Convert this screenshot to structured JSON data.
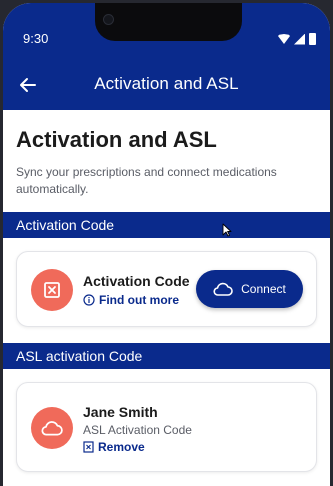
{
  "status_bar": {
    "time": "9:30"
  },
  "app_bar": {
    "title": "Activation and ASL",
    "back_icon": "arrow-left-icon"
  },
  "page": {
    "title": "Activation and ASL",
    "subtitle": "Sync your prescriptions and connect medications automatically."
  },
  "sections": {
    "activation": {
      "header": "Activation Code",
      "card": {
        "icon": "prescription-pad-icon",
        "title": "Activation Code",
        "link_label": "Find out more",
        "link_icon": "info-icon",
        "button_label": "Connect",
        "button_icon": "cloud-icon"
      }
    },
    "asl": {
      "header": "ASL activation Code",
      "card": {
        "icon": "cloud-icon",
        "name": "Jane Smith",
        "subtitle": "ASL Activation Code",
        "remove_label": "Remove",
        "remove_icon": "remove-icon"
      }
    }
  },
  "colors": {
    "primary": "#0a2a8c",
    "accent": "#f06a5a",
    "text": "#1b1b1b",
    "muted": "#5a5d66"
  }
}
